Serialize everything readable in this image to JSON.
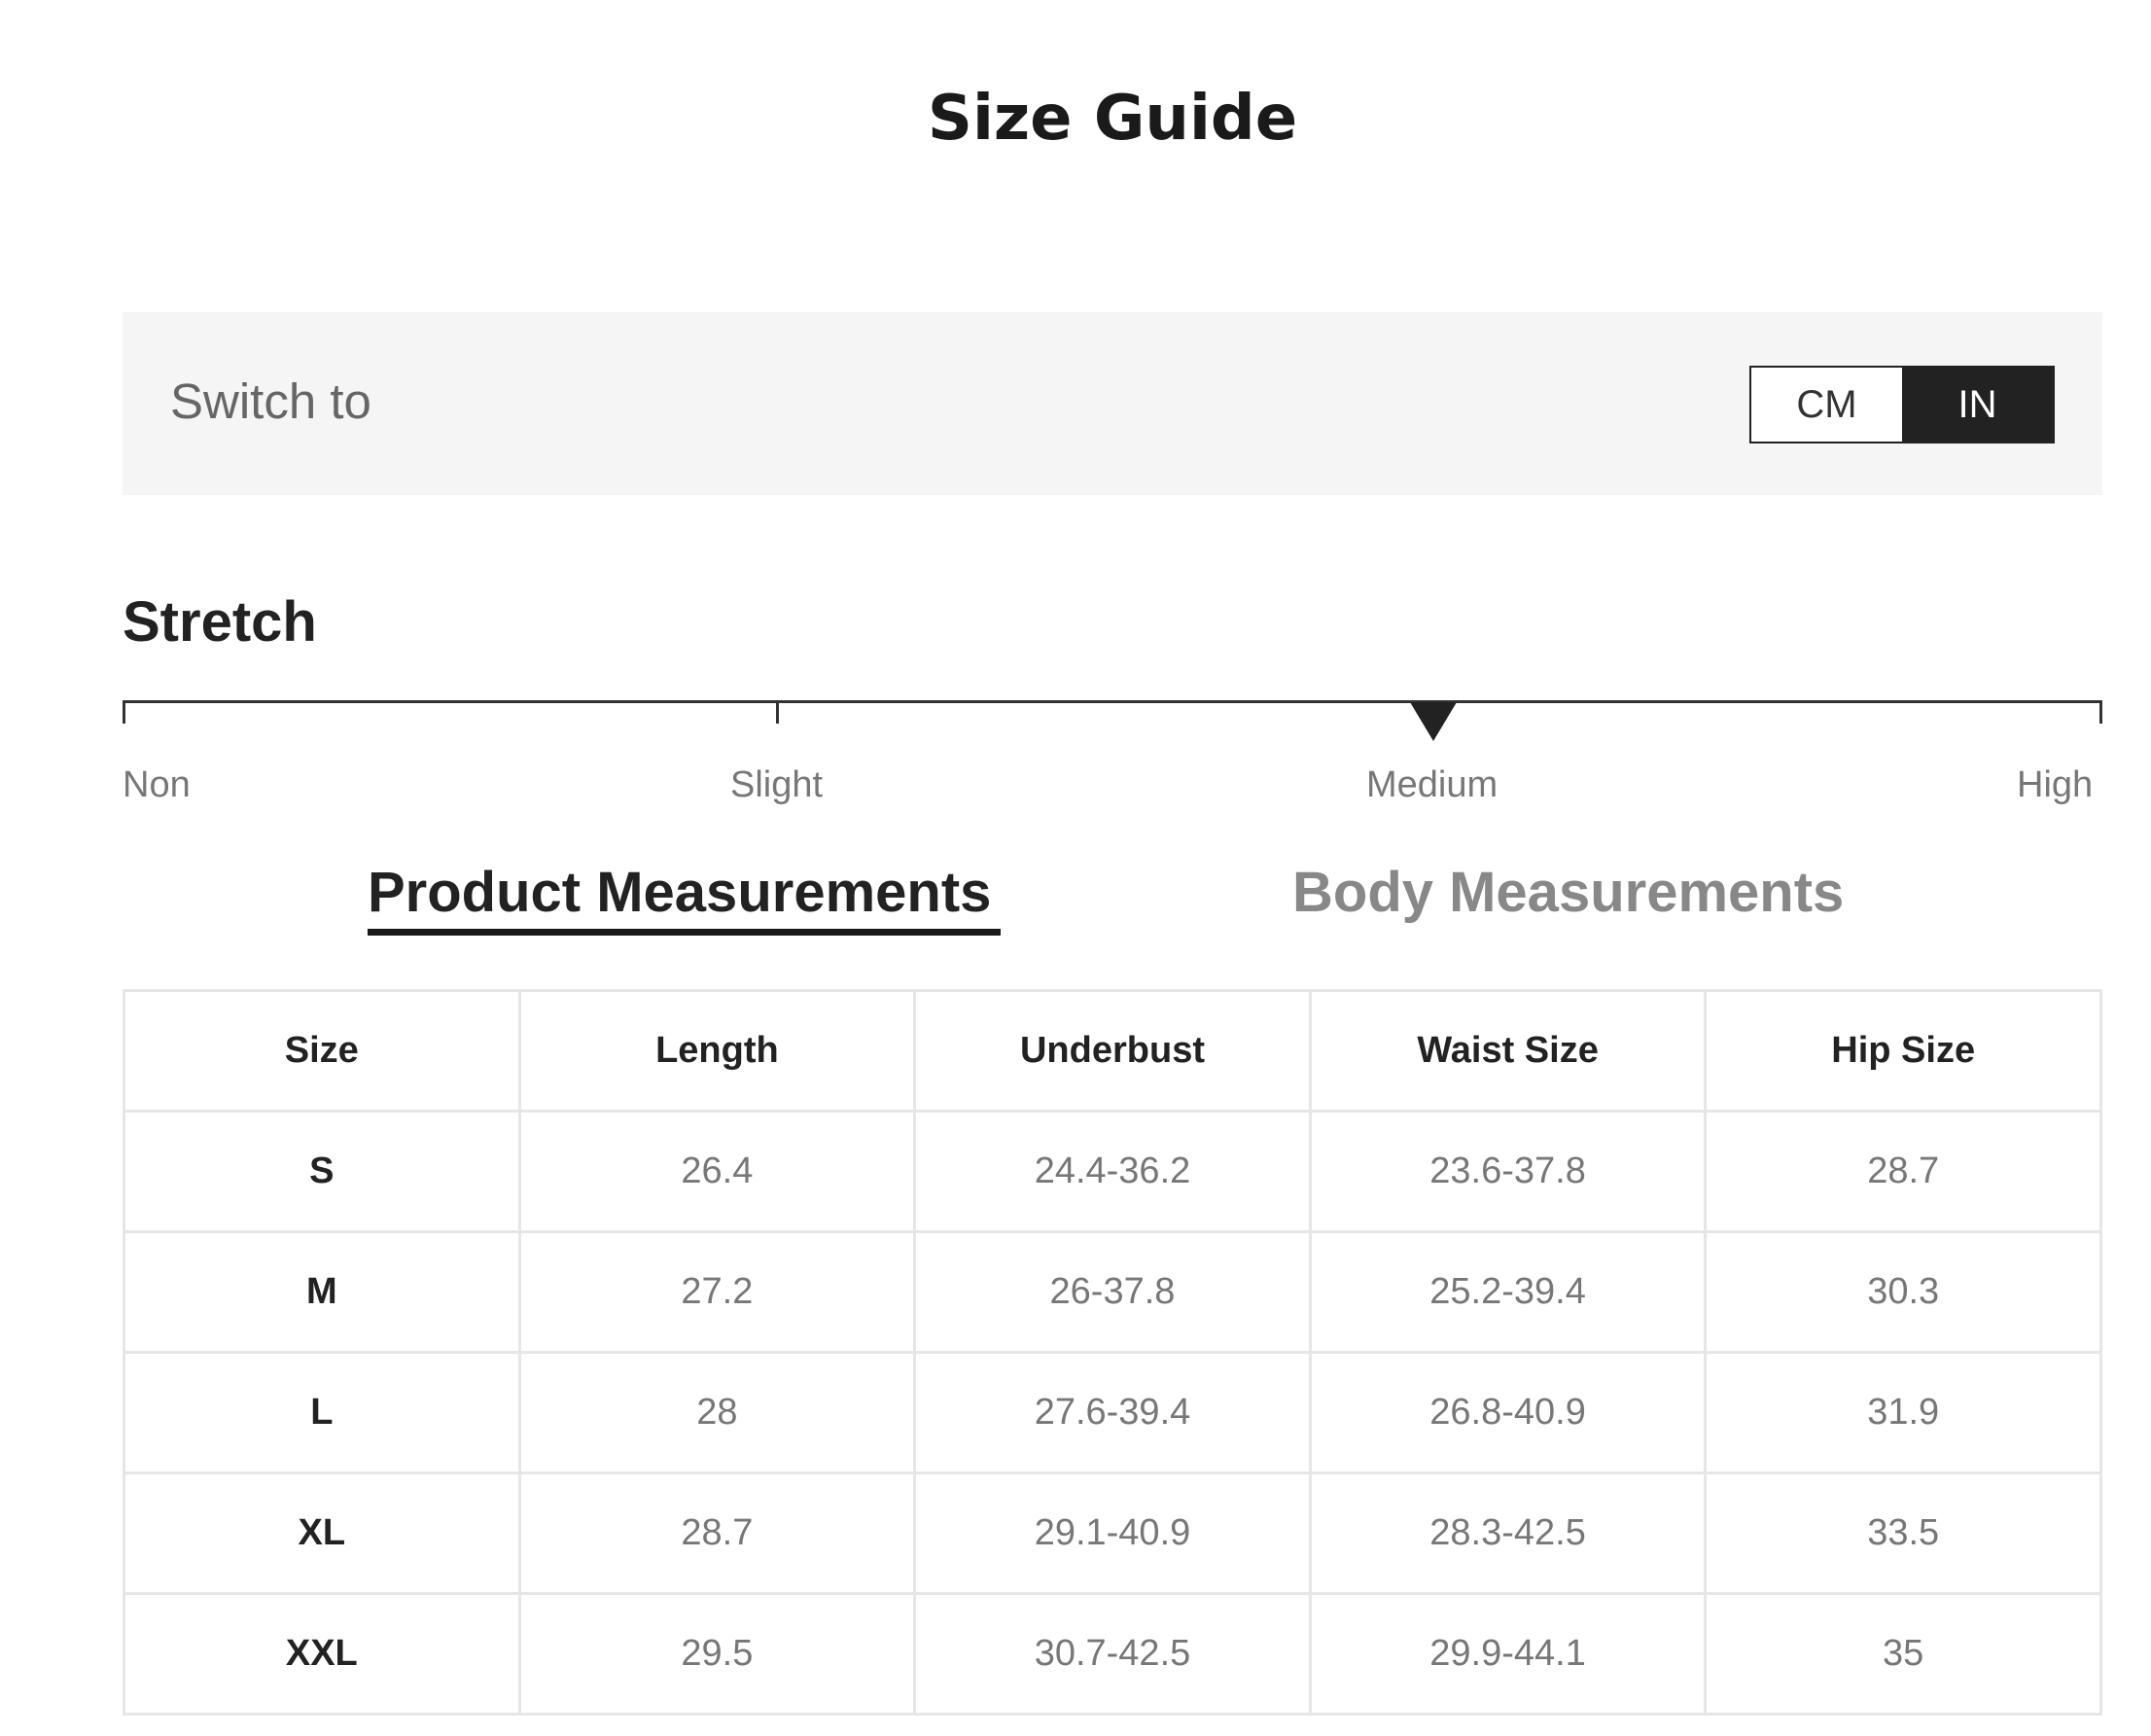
{
  "header": {
    "title": "Size Guide"
  },
  "unit_switch": {
    "label": "Switch to",
    "options": [
      "CM",
      "IN"
    ],
    "selected": "IN"
  },
  "stretch": {
    "heading": "Stretch",
    "levels": [
      "Non",
      "Slight",
      "Medium",
      "High"
    ],
    "selected": "Medium"
  },
  "tabs": [
    {
      "label": "Product Measurements",
      "active": true
    },
    {
      "label": "Body Measurements",
      "active": false
    }
  ],
  "table": {
    "columns": [
      "Size",
      "Length",
      "Underbust",
      "Waist Size",
      "Hip Size"
    ],
    "rows": [
      [
        "S",
        "26.4",
        "24.4-36.2",
        "23.6-37.8",
        "28.7"
      ],
      [
        "M",
        "27.2",
        "26-37.8",
        "25.2-39.4",
        "30.3"
      ],
      [
        "L",
        "28",
        "27.6-39.4",
        "26.8-40.9",
        "31.9"
      ],
      [
        "XL",
        "28.7",
        "29.1-40.9",
        "28.3-42.5",
        "33.5"
      ],
      [
        "XXL",
        "29.5",
        "30.7-42.5",
        "29.9-44.1",
        "35"
      ]
    ]
  },
  "colors": {
    "active_toggle_bg": "#222222",
    "panel_bg": "#f5f5f5",
    "muted_text": "#777777"
  }
}
